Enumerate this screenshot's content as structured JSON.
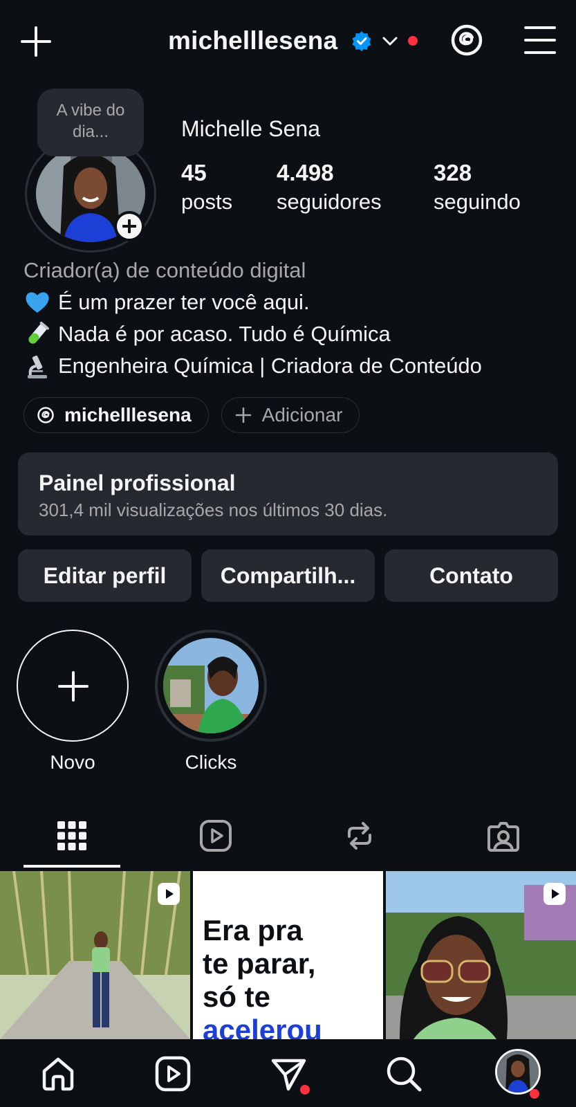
{
  "header": {
    "username": "michelllesena",
    "verified_color": "#0095f6",
    "notification_dot_color": "#ff3040",
    "icons": [
      "plus-icon",
      "verified-badge-icon",
      "chevron-down-icon",
      "threads-icon",
      "menu-icon"
    ]
  },
  "profile": {
    "note": "A vibe do dia...",
    "full_name": "Michelle Sena",
    "stats": [
      {
        "value": "45",
        "label": "posts"
      },
      {
        "value": "4.498",
        "label": "seguidores"
      },
      {
        "value": "328",
        "label": "seguindo"
      }
    ],
    "category": "Criador(a) de conteúdo digital",
    "bio_lines": [
      {
        "icon": "blue-heart-emoji",
        "text": "É um prazer ter você aqui."
      },
      {
        "icon": "test-tube-emoji",
        "text": "Nada é por acaso. Tudo é Química"
      },
      {
        "icon": "microscope-emoji",
        "text": "Engenheira Química | Criadora de Conteúdo"
      }
    ],
    "threads_pill": "michelllesena",
    "add_pill": "Adicionar"
  },
  "dashboard": {
    "title": "Painel profissional",
    "subtitle": "301,4 mil visualizações nos últimos 30 dias."
  },
  "actions": {
    "edit": "Editar perfil",
    "share": "Compartilh...",
    "contact": "Contato"
  },
  "highlights": [
    {
      "label": "Novo"
    },
    {
      "label": "Clicks"
    }
  ],
  "tabs": [
    "grid-icon",
    "reels-icon",
    "reposts-icon",
    "tagged-icon"
  ],
  "posts": {
    "text_post_lines": [
      "Era pra",
      "te parar,",
      "só te",
      "acelerou"
    ]
  },
  "bottom_nav": [
    "home-icon",
    "reels-icon",
    "direct-icon",
    "search-icon",
    "profile-avatar"
  ]
}
